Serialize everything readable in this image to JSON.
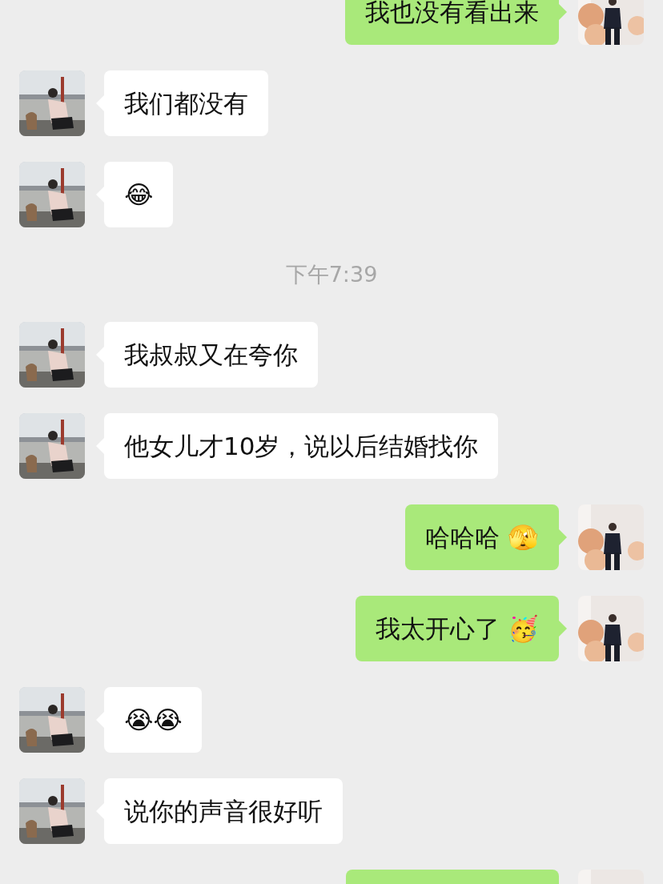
{
  "messages": [
    {
      "kind": "outgoing",
      "text": "我也没有看出来"
    },
    {
      "kind": "incoming",
      "text": "我们都没有"
    },
    {
      "kind": "incoming",
      "text": "😂"
    },
    {
      "kind": "time",
      "text": "下午7:39"
    },
    {
      "kind": "incoming",
      "text": "我叔叔又在夸你"
    },
    {
      "kind": "incoming",
      "text": "他女儿才10岁，说以后结婚找你"
    },
    {
      "kind": "outgoing",
      "text": "哈哈哈 🫣"
    },
    {
      "kind": "outgoing",
      "text": "我太开心了 🥳"
    },
    {
      "kind": "incoming",
      "text": "😭😭"
    },
    {
      "kind": "incoming",
      "text": "说你的声音很好听"
    },
    {
      "kind": "outgoing"
    }
  ]
}
